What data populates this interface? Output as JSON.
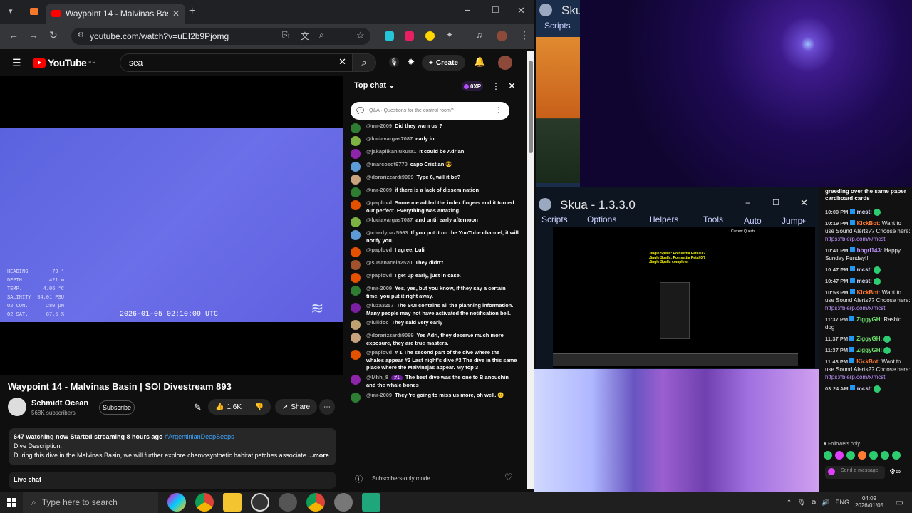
{
  "browser": {
    "tab_title": "Waypoint 14 - Malvinas Basi",
    "url": "youtube.com/watch?v=uEI2b9Pjomg"
  },
  "youtube": {
    "logo": "YouTube",
    "logo_sup": "FOR",
    "search_value": "sea",
    "create_label": "Create",
    "video": {
      "telemetry": [
        {
          "label": "HEADING",
          "value": "79 °"
        },
        {
          "label": "DEPTH",
          "value": "421 m"
        },
        {
          "label": "TEMP.",
          "value": "4.06 °C"
        },
        {
          "label": "SALINITY",
          "value": "34.01 PSU"
        },
        {
          "label": "O2 CON.",
          "value": "280 μM"
        },
        {
          "label": "O2 SAT.",
          "value": "87.5 %"
        }
      ],
      "timestamp": "2026-01-05 02:10:09 UTC"
    },
    "title": "Waypoint 14 - Malvinas Basin | SOI Divestream 893",
    "channel": {
      "name": "Schmidt Ocean",
      "subs": "568K subscribers",
      "subscribe": "Subscribe"
    },
    "likes": "1.6K",
    "share": "Share",
    "description": {
      "stats": "647 watching now  Started streaming 8 hours ago",
      "hashtag": "#ArgentinianDeepSeeps",
      "heading": "Dive Description:",
      "body": "During this dive in the Malvinas Basin, we will further explore chemosynthetic habitat patches associate",
      "more": "...more"
    },
    "live_chat_label": "Live chat"
  },
  "chat": {
    "header": "Top chat",
    "xp": "0XP",
    "pinned": "Q&A · Questions for the control room?",
    "messages": [
      {
        "author": "@mr-2009",
        "text": "Did they warn us ?",
        "color": "#2e7d32"
      },
      {
        "author": "@luciavargas7087",
        "text": "early in",
        "color": "#7cb342"
      },
      {
        "author": "@jakapilkanlukura1",
        "text": "It could be Adrian",
        "color": "#8e24aa"
      },
      {
        "author": "@marcosdt9770",
        "text": "capo Cristian 😎",
        "color": "#5c9bd6"
      },
      {
        "author": "@dorarizzardi9069",
        "text": "Type 6, will it be?",
        "color": "#c9a27e"
      },
      {
        "author": "@mr-2009",
        "text": "if there is a lack of dissemination",
        "color": "#2e7d32"
      },
      {
        "author": "@paplovd",
        "text": "Someone added the index fingers and it turned out perfect. Everything was amazing.",
        "color": "#e65100"
      },
      {
        "author": "@luciavargas7087",
        "text": "and until early afternoon",
        "color": "#7cb342"
      },
      {
        "author": "@charlypaz5963",
        "text": "If you put it on the YouTube channel, it will notify you.",
        "color": "#5c9bd6"
      },
      {
        "author": "@paplovd",
        "text": "I agree, Luli",
        "color": "#e65100"
      },
      {
        "author": "@susanacela2520",
        "text": "They didn't",
        "color": "#a0522d"
      },
      {
        "author": "@paplovd",
        "text": "I get up early, just in case.",
        "color": "#e65100"
      },
      {
        "author": "@mr-2009",
        "text": "Yes, yes, but you know, if they say a certain time, you put it right away.",
        "color": "#2e7d32"
      },
      {
        "author": "@luza3257",
        "text": "The SOI contains all the planning information. Many people may not have activated the notification bell.",
        "color": "#7b1fa2"
      },
      {
        "author": "@lulidoc",
        "text": "They said very early",
        "color": "#bfa070"
      },
      {
        "author": "@dorarizzardi9069",
        "text": "Yes Adri, they deserve much more exposure, they are true masters.",
        "color": "#c9a27e"
      },
      {
        "author": "@paplovd",
        "text": "# 1 The second part of the dive where the whales appear #2 Last night's dive #3 The dive in this same place where the Malvinejas appear. My top 3",
        "color": "#e65100"
      },
      {
        "author": "@Mhh_8",
        "badge": "#1",
        "text": "The best dive was the one to Blanouchin and the whale bones",
        "color": "#8e24aa"
      },
      {
        "author": "@mr-2009",
        "text": "They 're going to miss us more, oh well. 🙂",
        "color": "#2e7d32"
      }
    ],
    "footer": "Subscribers-only mode"
  },
  "skua": {
    "small_title": "Sku",
    "small_menu": "Scripts",
    "title": "Skua - 1.3.3.0",
    "menu": [
      "Scripts",
      "Options",
      "Helpers",
      "Tools",
      "Auto",
      "Jump",
      "+"
    ],
    "quest_label": "Current Quests",
    "quest_lines": [
      "Jingle Spells: Poinsettia Petal 0/7",
      "Jingle Spells: Poinsettia Petal 0/7",
      "Jingle Spells complete!"
    ]
  },
  "twitch": {
    "top_text": "greeding over the same paper cardboard cards",
    "messages": [
      {
        "time": "10:09 PM",
        "name": "mcst:",
        "name_color": "#e0e0ff",
        "text": "",
        "link": ""
      },
      {
        "time": "10:19 PM",
        "name": "KickBot:",
        "name_color": "#ff7a33",
        "text": "Want to use Sound Alerts?? Choose here:",
        "link": "https://blerp.com/x/mcst"
      },
      {
        "time": "10:41 PM",
        "name": "bbgrl143:",
        "name_color": "#bf94ff",
        "text": "Happy Sunday Funday!!",
        "link": ""
      },
      {
        "time": "10:47 PM",
        "name": "mcst:",
        "name_color": "#e0e0ff",
        "text": "",
        "link": ""
      },
      {
        "time": "10:47 PM",
        "name": "mcst:",
        "name_color": "#e0e0ff",
        "text": "",
        "link": ""
      },
      {
        "time": "10:53 PM",
        "name": "KickBot:",
        "name_color": "#ff7a33",
        "text": "Want to use Sound Alerts?? Choose here:",
        "link": "https://blerp.com/x/mcst"
      },
      {
        "time": "11:37 PM",
        "name": "ZiggyGH:",
        "name_color": "#6ee06e",
        "text": "Rashid dog",
        "link": ""
      },
      {
        "time": "11:37 PM",
        "name": "ZiggyGH:",
        "name_color": "#6ee06e",
        "text": "",
        "link": ""
      },
      {
        "time": "11:37 PM",
        "name": "ZiggyGH:",
        "name_color": "#6ee06e",
        "text": "",
        "link": ""
      },
      {
        "time": "11:43 PM",
        "name": "KickBot:",
        "name_color": "#ff7a33",
        "text": "Want to use Sound Alerts?? Choose here:",
        "link": "https://blerp.com/x/mcst"
      },
      {
        "time": "03:24 AM",
        "name": "mcst:",
        "name_color": "#e0e0ff",
        "text": "",
        "link": ""
      }
    ],
    "followers_only": "Followers only",
    "send_placeholder": "Send a message"
  },
  "taskbar": {
    "search_placeholder": "Type here to search",
    "lang": "ENG",
    "time": "04:09",
    "date": "2026/01/05"
  },
  "colors": {
    "yt_red": "#ff0000",
    "chat_bg": "#0f0f0f",
    "video_blue": "#5a63de",
    "cam_purple": "#3d1a8a"
  }
}
